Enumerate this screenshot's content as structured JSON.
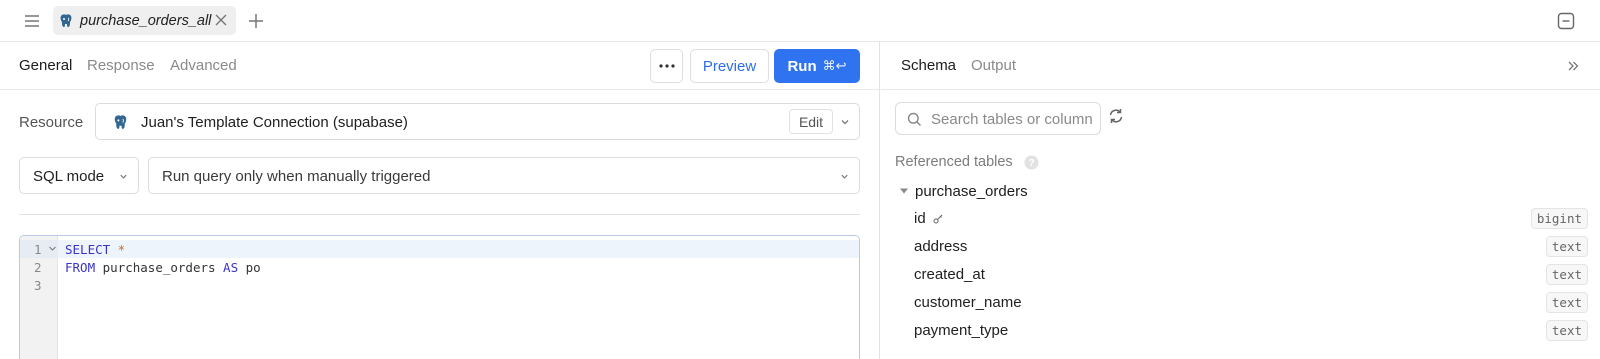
{
  "topbar": {
    "tab_name": "purchase_orders_all"
  },
  "editor_tabs": {
    "items": [
      {
        "label": "General",
        "active": true
      },
      {
        "label": "Response",
        "active": false
      },
      {
        "label": "Advanced",
        "active": false
      }
    ],
    "preview_label": "Preview",
    "run_label": "Run",
    "run_shortcut": "⌘↩"
  },
  "resource": {
    "label": "Resource",
    "name": "Juan's Template Connection (supabase)",
    "edit_label": "Edit"
  },
  "options": {
    "mode": "SQL mode",
    "trigger": "Run query only when manually triggered"
  },
  "code": {
    "line_numbers": [
      "1",
      "2",
      "3"
    ],
    "line1": {
      "kw": "SELECT",
      "rest": " *"
    },
    "line2": {
      "kw1": "FROM",
      "ident": " purchase_orders ",
      "kw2": "AS",
      "alias": " po"
    },
    "line3": ""
  },
  "schema_panel": {
    "tabs": [
      {
        "label": "Schema",
        "active": true
      },
      {
        "label": "Output",
        "active": false
      }
    ],
    "search_placeholder": "Search tables or column",
    "referenced_label": "Referenced tables",
    "table_name": "purchase_orders",
    "columns": [
      {
        "name": "id",
        "type": "bigint",
        "primary_key": true
      },
      {
        "name": "address",
        "type": "text"
      },
      {
        "name": "created_at",
        "type": "text"
      },
      {
        "name": "customer_name",
        "type": "text"
      },
      {
        "name": "payment_type",
        "type": "text"
      }
    ]
  },
  "colors": {
    "accent": "#2f73f0",
    "keyword": "#3a34c9",
    "operator": "#c96b1e"
  },
  "icons": [
    "menu-icon",
    "postgres-icon",
    "close-icon",
    "plus-icon",
    "collapse-panel-icon",
    "more-icon",
    "chevron-down-icon",
    "fold-icon",
    "expand-panel-icon",
    "search-icon",
    "refresh-icon",
    "help-icon",
    "caret-down-icon",
    "key-icon"
  ]
}
